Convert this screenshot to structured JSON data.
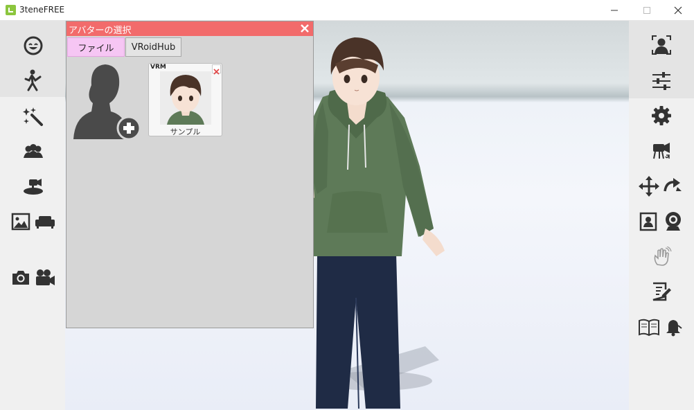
{
  "window": {
    "title": "3teneFREE"
  },
  "colors": {
    "accent": "#f26b6b",
    "tab_active": "#f6c6f4",
    "icon": "#333333"
  },
  "left_toolbar": {
    "items": [
      "face-icon",
      "pose-icon",
      "effects-icon",
      "group-icon",
      "camera-stage-icon",
      "background-image-icon",
      "sofa-icon",
      "photo-camera-icon",
      "video-camera-icon"
    ]
  },
  "right_toolbar": {
    "items": [
      "face-tracking-icon",
      "sliders-icon",
      "gear-icon",
      "camera-switch-icon",
      "move-icon",
      "rotate-icon",
      "portrait-icon",
      "webcam-icon",
      "hand-wave-icon",
      "edit-note-icon",
      "book-icon",
      "bell-icon"
    ]
  },
  "dialog": {
    "title": "アバターの選択",
    "tabs": [
      {
        "label": "ファイル",
        "active": true
      },
      {
        "label": "VRoidHub",
        "active": false
      }
    ],
    "avatars": [
      {
        "badge": "VRM",
        "name": "サンプル"
      }
    ]
  }
}
